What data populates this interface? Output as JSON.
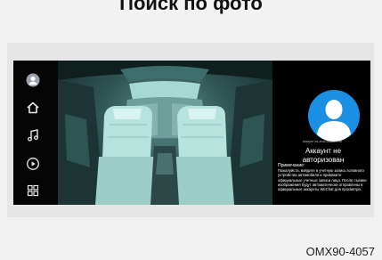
{
  "header": {
    "title": "Поиск по фото"
  },
  "sidebar": {
    "items": [
      {
        "icon": "profile-icon"
      },
      {
        "icon": "home-icon"
      },
      {
        "icon": "music-icon"
      },
      {
        "icon": "play-icon"
      },
      {
        "icon": "apps-icon"
      }
    ]
  },
  "camera": {
    "view": "cabin-camera-view"
  },
  "account": {
    "caption": "Аккаунт на этой машине не",
    "status": "Аккаунт не авторизован",
    "note_title": "Примечание:",
    "note": "Пожалуйста, войдите в учетную запись головного устройства автомобиля и привяжите официальные учетные записи лица. После съемки изображения будут автоматически отправлены в официальные аккаунты WeChat для просмотра.",
    "avatar_color": "#1a8fe3"
  },
  "footer": {
    "code": "OMX90-4057"
  }
}
